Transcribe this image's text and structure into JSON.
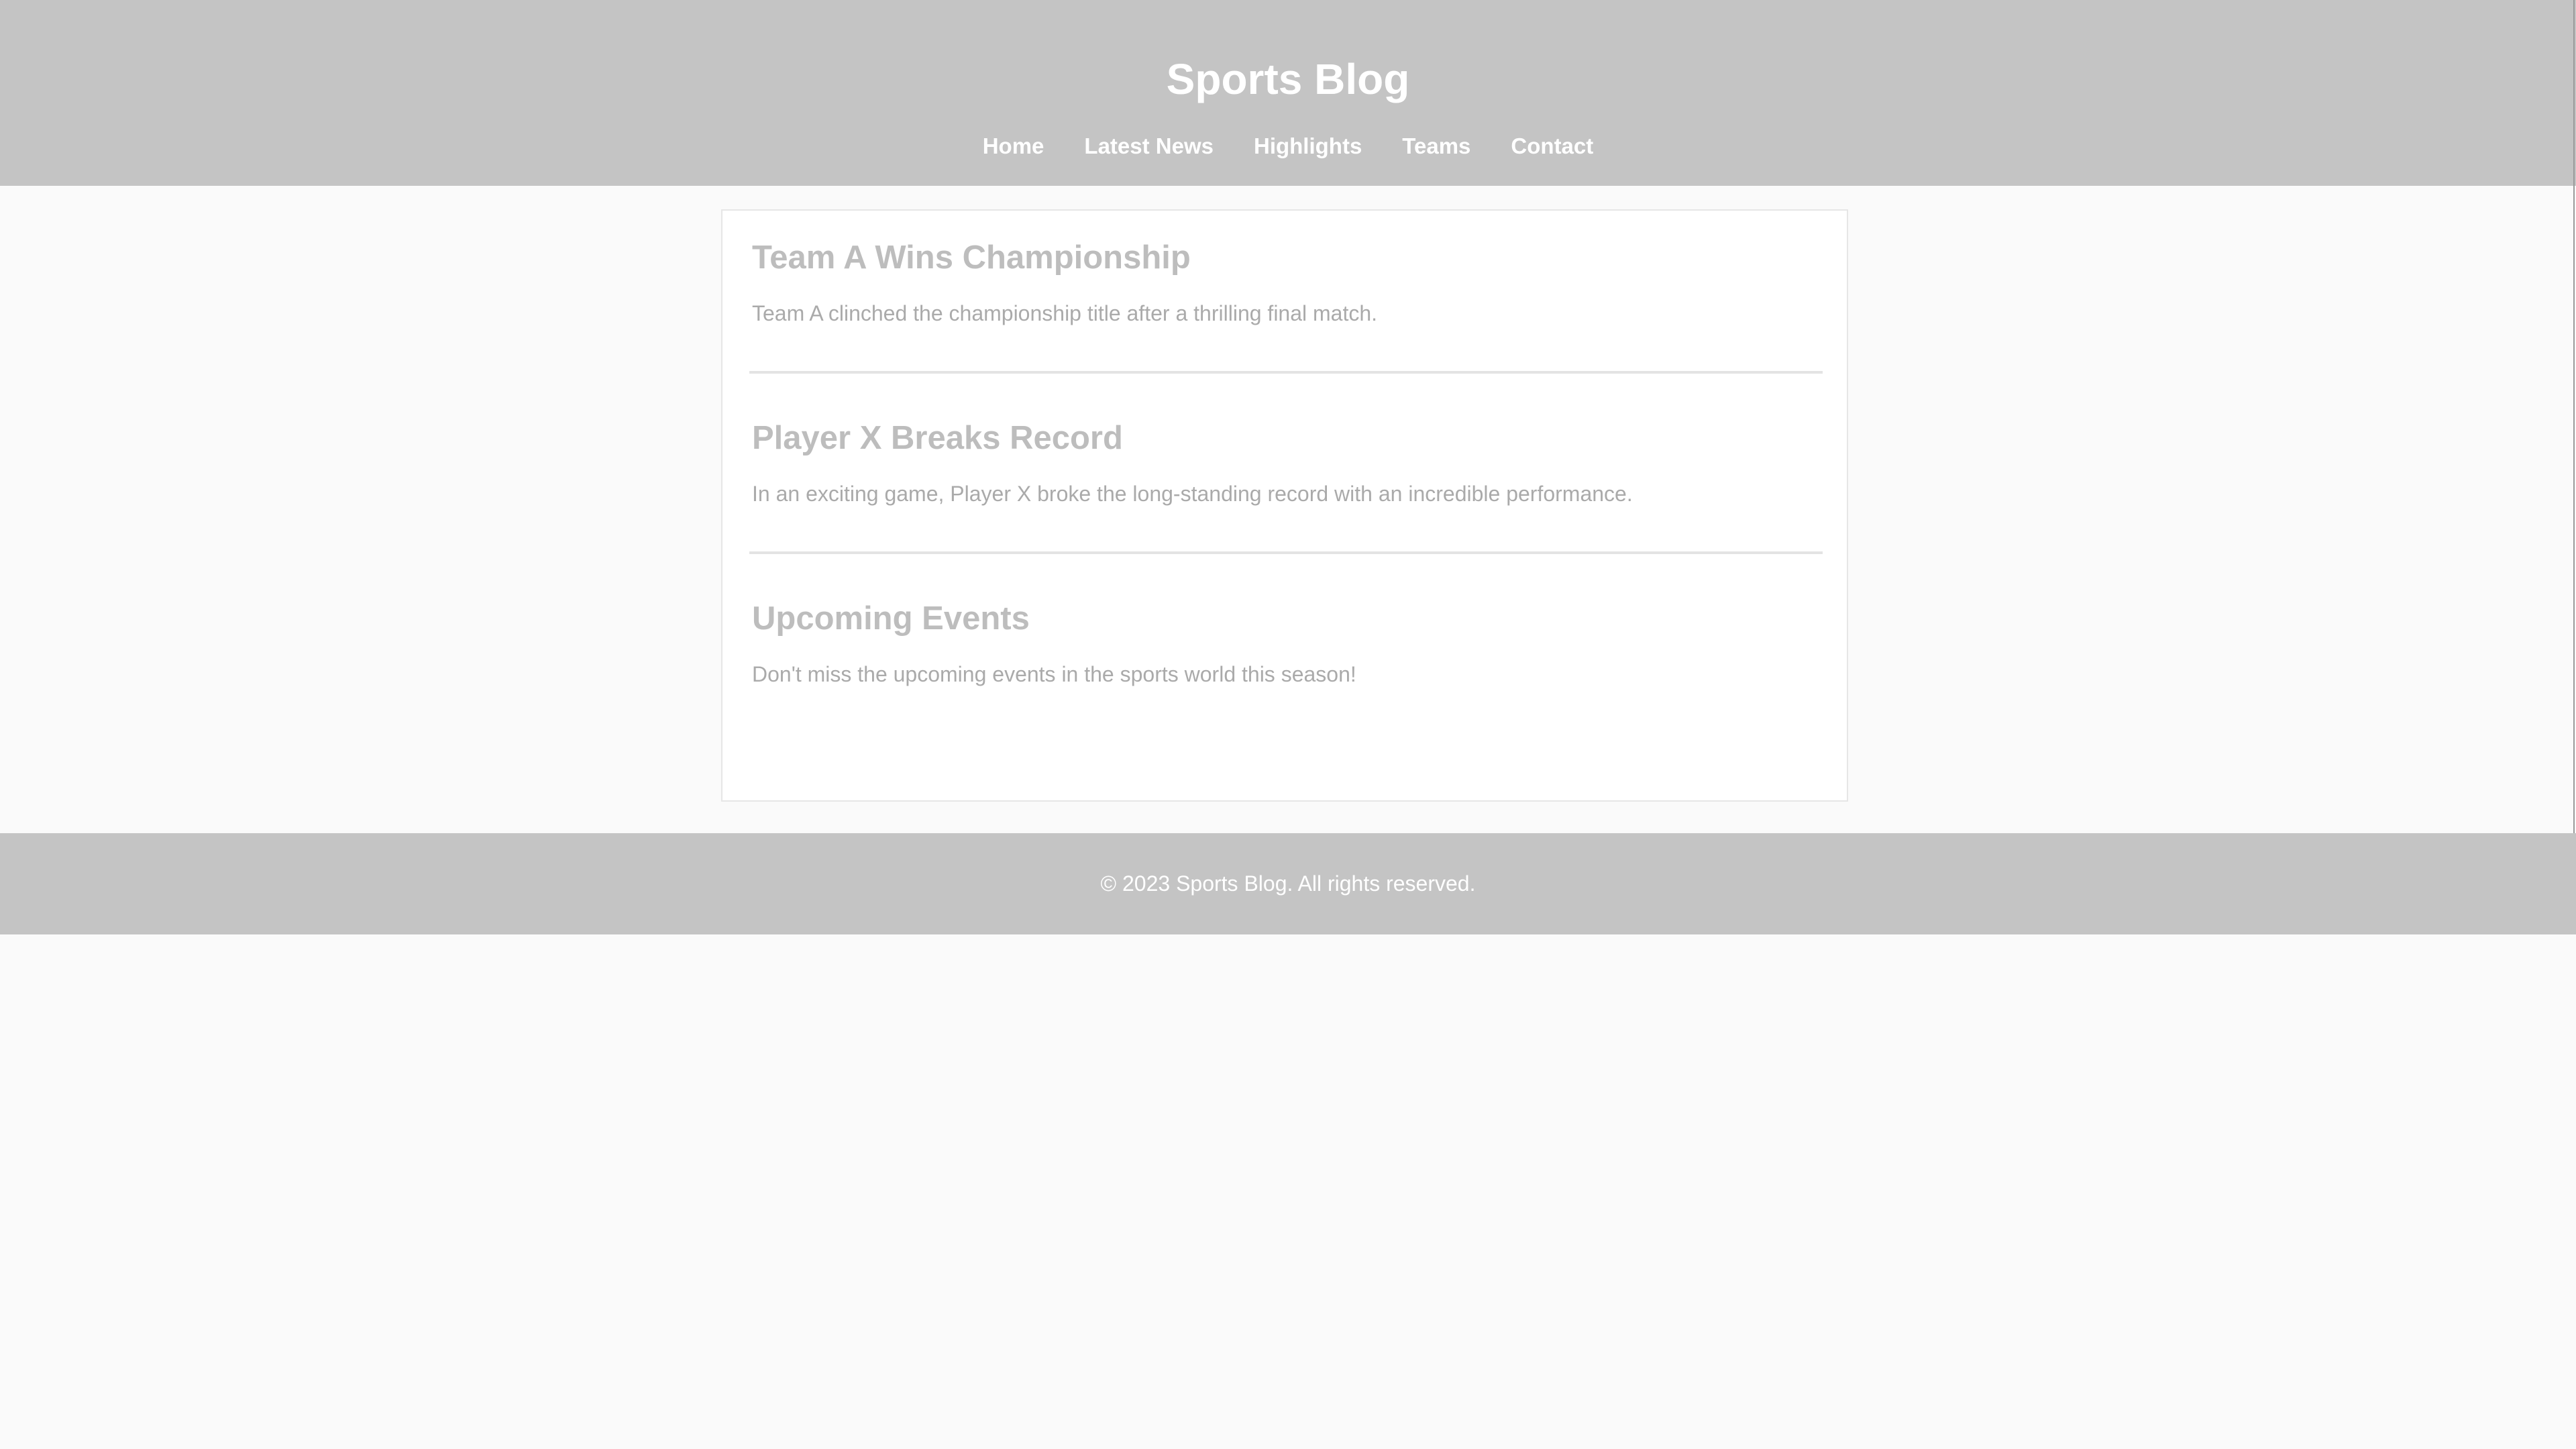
{
  "header": {
    "title": "Sports Blog",
    "nav": [
      {
        "label": "Home"
      },
      {
        "label": "Latest News"
      },
      {
        "label": "Highlights"
      },
      {
        "label": "Teams"
      },
      {
        "label": "Contact"
      }
    ]
  },
  "articles": [
    {
      "title": "Team A Wins Championship",
      "body": "Team A clinched the championship title after a thrilling final match."
    },
    {
      "title": "Player X Breaks Record",
      "body": "In an exciting game, Player X broke the long-standing record with an incredible performance."
    },
    {
      "title": "Upcoming Events",
      "body": "Don't miss the upcoming events in the sports world this season!"
    }
  ],
  "footer": {
    "text": "© 2023 Sports Blog. All rights reserved."
  },
  "colors": {
    "header_bg": "#c4c4c4",
    "page_bg": "#fafafa",
    "heading": "#bdbdbd",
    "body_text": "#aaaaaa"
  }
}
